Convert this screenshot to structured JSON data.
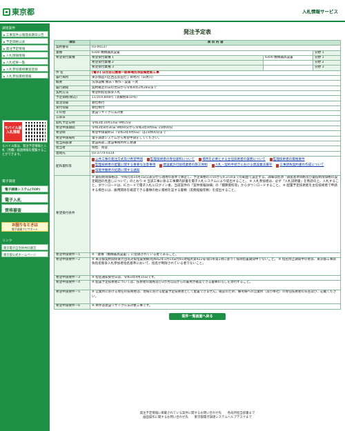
{
  "header": {
    "logo_text": "東京都",
    "service_name": "入札情報サービス"
  },
  "sidebar": {
    "section1": "調達案件",
    "menu": [
      "工事案件公報発表期日公告",
      "予定価格公表",
      "発注予定情報",
      "入札情報情報",
      "入札結果一覧",
      "入札参加資格審査登録",
      "入札参加資格情報"
    ],
    "mobile_label": "モバイル版",
    "mobile_sub": "入札情報",
    "mobile_note": "モバイル版は、発注予定情報と入札（見積）経過情報を閲覧することができます。",
    "section2": "電子調達",
    "ebtn1": "電子調達システム(TOP)",
    "ebtn2": "電子入札",
    "ebtn3": "資格審査",
    "news_title": "お困りなときは",
    "news_sub": "電子調達ナビサポート",
    "section3": "リンク",
    "links": [
      "東京電子自治体共同運営",
      "東京都公式ホームページ"
    ]
  },
  "page_title": "発注予定表",
  "table": {
    "head_item": "項目",
    "head_content": "項 目 内 容",
    "rows": [
      [
        "契約番号",
        "03-00137"
      ],
      [
        "業種",
        "6300 機械器具設置"
      ],
      [
        "件 名",
        "[電子] 日比谷公園第一駐車場洗浄設備更新工事"
      ],
      [
        "履行場所",
        "東京都品川区西五反田七丁目地内（日黒川）"
      ],
      [
        "概要",
        "洗浄設備 撤去・製作・設置 一式"
      ],
      [
        "履行期間",
        "契約確定の日の翌日から令和4年2月28日まで"
      ],
      [
        "契約方法",
        "希望制指名競争入札"
      ],
      [
        "予定価格(税込)",
        "11,019,800円（消費税率10%）"
      ],
      [
        "発注等級",
        "順位格付"
      ],
      [
        "受付等級",
        "順位格付"
      ],
      [
        "その他",
        "建設リサイクル法対象"
      ],
      [
        "公表日",
        "令和3年10月14日 9時15分"
      ],
      [
        "開札予定日時",
        "令和3年10月14日 9時15分"
      ],
      [
        "希望申請期間",
        "令和3年8月30日 9時00分から令和3年9月6日 15時00分"
      ],
      [
        "希望締",
        "希望申請最終日（令和3年9月6日）は15時00分まで"
      ],
      [
        "希望申請場所",
        "電子調達システムから希望申請をしてください。"
      ],
      [
        "担当局部課",
        "建設局第二建設事務所所工務課"
      ],
      [
        "担当者",
        "償担、南雲"
      ],
      [
        "連絡先",
        "03-3774-0314"
      ]
    ],
    "kibou": {
      "label": "希望受付業種",
      "items": [
        [
          "希望受付業種 1",
          "6300 機械器具設置",
          "分野 1"
        ],
        [
          "希望受付業種 2",
          "",
          "分野 2"
        ],
        [
          "希望受付業種 3",
          "",
          "分野 3"
        ]
      ]
    },
    "haifu_label": "配布資料等",
    "haifu_links": [
      "公共工事の発注方式及び希望申請",
      "監理技術者の専任緩和について",
      "場所を必要とする主任技術者の兼務について",
      "監理技術者の資格要件",
      "監理技術者の配置に関する重要な注意事項",
      "建設業許可取得業者の施工体制",
      "入札・契約手続きにおける建設業法遵守",
      "工事請負契約書の作成について",
      "技能労働者の処遇に関する通知"
    ],
    "shikaku_label": "希望受付条件",
    "shikaku_text": "※ 最低制限価格は、今和元年10月1日公表分から適用の基準で算定し、予定価格の7/10から9.2/10までの範囲で設定する。詳細は別添「調査基準価格及び最低制限価格の設定範囲の見直しについて」のとおり ※ 当該工事に係る工事費内訳書を電子入札システムにより提出すること。 ※ 入札参加者は、必ず「入札説明書」を熟読の上、入札すること。ダウンロードは、ICカードで電子入札にログイン後、当該案件の「案件情報詳細」の「積算資料等」からダウンロードすること。 ※ 配置予定技術者を主任技術者で申請する場合には、雇用関係を確認できる書類の他に資格を証する書類（実務経験年数）を提出すること。",
    "reqs": [
      [
        "希望申請要件－1",
        "※「業種（機械器具設置）」に登録されている者であること。"
      ],
      [
        "希望申請要件－2",
        "※ 東京都契約関係暴力団等対策措置要綱(昭和62年1月14日付61財経庶第922号)第5条第1項に基づく排除措置期間中でないこと。 ※ 指名停止期間中の者等、東京都工事請負指名競争入札参加者指名基準において、指名が制限されている者でないこと。"
      ],
      [
        "希望申請要件－3",
        "※ 指名通知受付日は、令和3年9月15日です。"
      ],
      [
        "希望申請要件－4",
        "※ 配置予定技術者については、技術者の資格及び3か月以前からの雇用が確認できる書類の写しを添付すること。"
      ],
      [
        "希望申請要件－5",
        "※ 営業所における専任の技術者は、現場における配置予定技術者として配置できません。確認のため、備考欄への営業所（及び本社）の専任技術者の氏名及び、記載ください。"
      ],
      [
        "希望申請要件－6",
        "※ 本件は建設リサイクル法対象工事です。"
      ]
    ]
  },
  "list_button": "案件一覧画面へ戻る",
  "footer": [
    "発注予定情報に掲載されている案件に関するお問い合わせ先　　各局所担当部署まで",
    "画面操作に関するお問い合わせ先　　東京都電子調達システムヘルプデスクまで"
  ]
}
